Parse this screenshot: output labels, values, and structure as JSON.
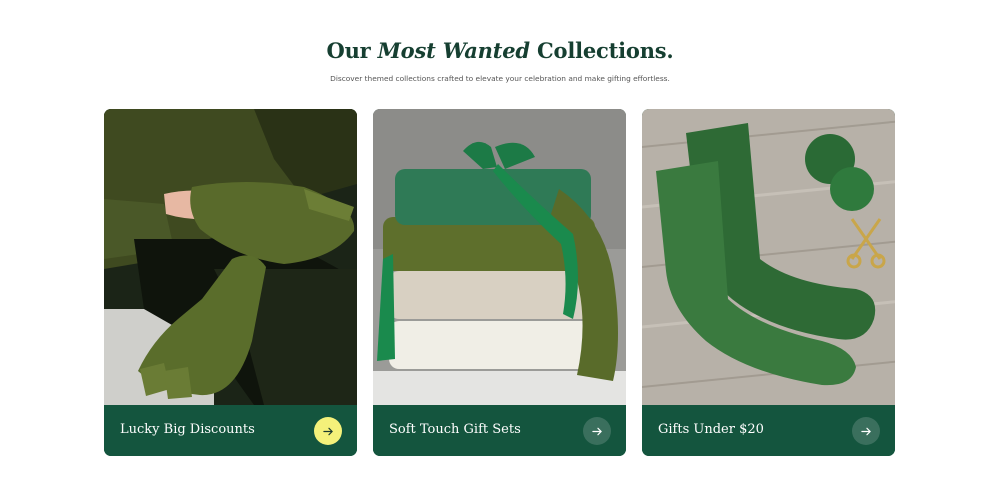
{
  "section": {
    "heading_pre": "Our ",
    "heading_em": "Most Wanted",
    "heading_post": " Collections.",
    "subtitle": "Discover themed collections crafted to elevate your celebration and make gifting effortless."
  },
  "cards": [
    {
      "title": "Lucky Big Discounts",
      "icon": "arrow-right-icon",
      "button_color": "#f4f17a",
      "image": "green knit gloves on woman"
    },
    {
      "title": "Soft Touch Gift Sets",
      "icon": "arrow-right-icon",
      "button_color": "#3a6f5d",
      "image": "stack of knit sweaters with green ribbon"
    },
    {
      "title": "Gifts Under $20",
      "icon": "arrow-right-icon",
      "button_color": "#3a6f5d",
      "image": "green knit socks with yarn and scissors"
    }
  ],
  "colors": {
    "brand_green": "#14553e",
    "heading": "#163f31",
    "accent_yellow": "#f4f17a"
  }
}
